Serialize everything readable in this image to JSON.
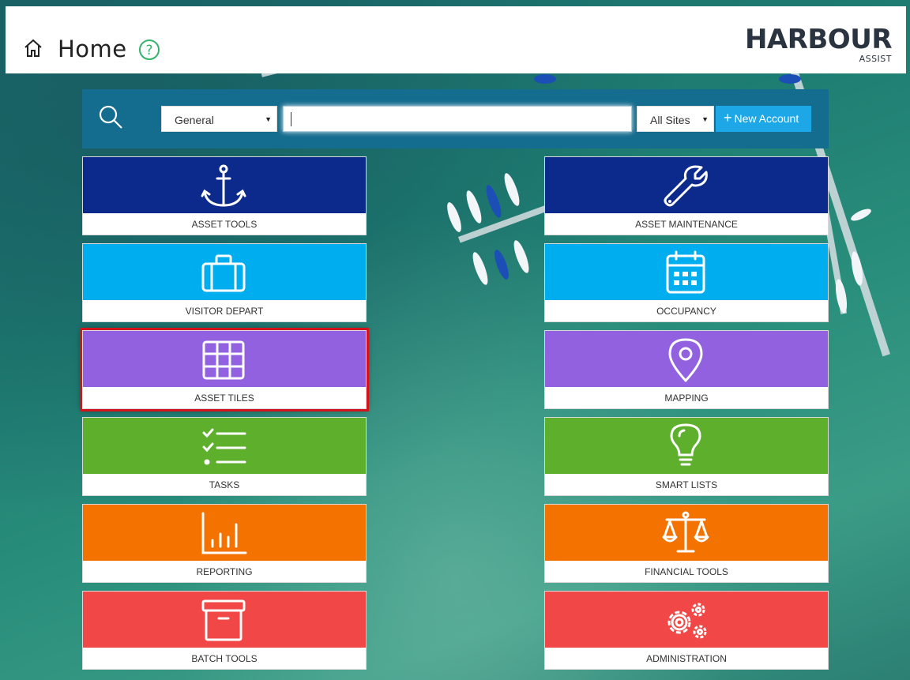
{
  "header": {
    "title": "Home",
    "home_icon": "home-icon",
    "help_icon": "help-circle-icon",
    "logo": {
      "main": "HARBOUR",
      "sub": "ASSIST"
    }
  },
  "search": {
    "icon": "search-icon",
    "category_select": {
      "value": "General"
    },
    "query_input": {
      "value": ""
    },
    "sites_select": {
      "value": "All Sites"
    },
    "new_account_label": "New Account"
  },
  "colors": {
    "navy": "#0b2a8c",
    "sky": "#00aeef",
    "purple": "#9161e0",
    "green": "#5daf2c",
    "orange": "#f37200",
    "red": "#f24747",
    "searchbar": "#146c8e",
    "button": "#1da7e6",
    "selection_outline": "#d4141c"
  },
  "tiles": {
    "left": [
      {
        "label": "ASSET TOOLS",
        "icon": "anchor-icon"
      },
      {
        "label": "VISITOR DEPART",
        "icon": "suitcase-icon"
      },
      {
        "label": "ASSET TILES",
        "icon": "grid-icon",
        "selected": true
      },
      {
        "label": "TASKS",
        "icon": "checklist-icon"
      },
      {
        "label": "REPORTING",
        "icon": "bar-chart-icon"
      },
      {
        "label": "BATCH TOOLS",
        "icon": "archive-box-icon"
      }
    ],
    "right": [
      {
        "label": "ASSET MAINTENANCE",
        "icon": "wrench-icon"
      },
      {
        "label": "OCCUPANCY",
        "icon": "calendar-icon"
      },
      {
        "label": "MAPPING",
        "icon": "map-pin-icon"
      },
      {
        "label": "SMART LISTS",
        "icon": "lightbulb-icon"
      },
      {
        "label": "FINANCIAL TOOLS",
        "icon": "scales-icon"
      },
      {
        "label": "ADMINISTRATION",
        "icon": "gears-icon"
      }
    ]
  }
}
